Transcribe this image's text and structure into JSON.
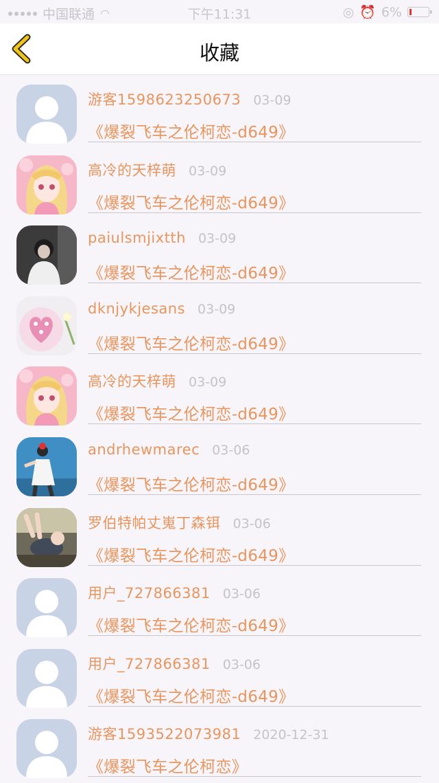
{
  "status_bar": {
    "carrier": "中国联通",
    "time": "下午11:31",
    "battery": "6%"
  },
  "nav": {
    "title": "收藏",
    "back_icon": "chevron-left-icon",
    "accent": "#f0c419"
  },
  "colors": {
    "name": "#e8955e",
    "date": "#c5c2c8",
    "background": "#f7f5f9"
  },
  "items": [
    {
      "name": "游客1598623250673",
      "date": "03-09",
      "title": "《爆裂飞车之伦柯恋-d649》",
      "avatar": "default-avatar"
    },
    {
      "name": "高冷的天梓萌",
      "date": "03-09",
      "title": "《爆裂飞车之伦柯恋-d649》",
      "avatar": "anime-girl-avatar"
    },
    {
      "name": "paiulsmjixtth",
      "date": "03-09",
      "title": "《爆裂飞车之伦柯恋-d649》",
      "avatar": "dark-photo-avatar"
    },
    {
      "name": "dknjykjesans",
      "date": "03-09",
      "title": "《爆裂飞车之伦柯恋-d649》",
      "avatar": "heart-cake-avatar"
    },
    {
      "name": "高冷的天梓萌",
      "date": "03-09",
      "title": "《爆裂飞车之伦柯恋-d649》",
      "avatar": "anime-girl-avatar"
    },
    {
      "name": "andrhewmarec",
      "date": "03-06",
      "title": "《爆裂飞车之伦柯恋-d649》",
      "avatar": "girl-blue-wall-avatar"
    },
    {
      "name": "罗伯特帕丈嵬丁森铒",
      "date": "03-06",
      "title": "《爆裂飞车之伦柯恋-d649》",
      "avatar": "baby-photo-avatar"
    },
    {
      "name": "用户_727866381",
      "date": "03-06",
      "title": "《爆裂飞车之伦柯恋-d649》",
      "avatar": "default-avatar"
    },
    {
      "name": "用户_727866381",
      "date": "03-06",
      "title": "《爆裂飞车之伦柯恋-d649》",
      "avatar": "default-avatar"
    },
    {
      "name": "游客1593522073981",
      "date": "2020-12-31",
      "title": "《爆裂飞车之伦柯恋》",
      "avatar": "default-avatar"
    }
  ]
}
